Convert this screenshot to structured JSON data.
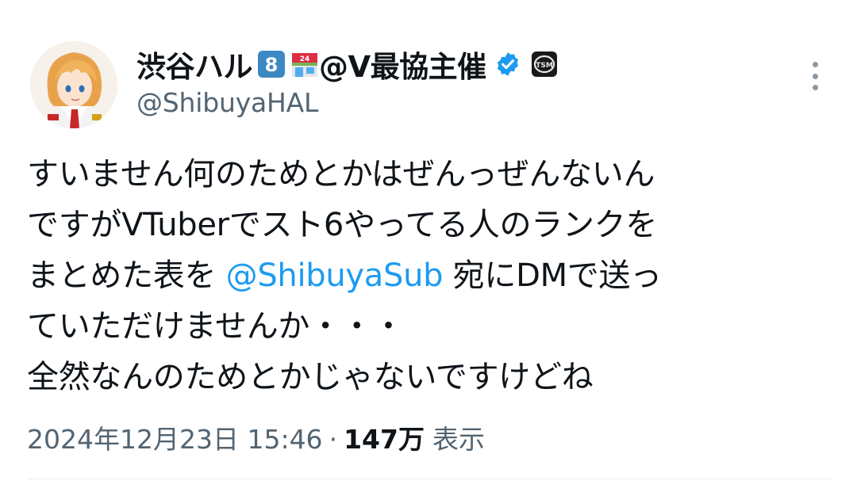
{
  "author": {
    "display_name": "渋谷ハル",
    "badge_number": "8",
    "store_badge_number": "24",
    "name_suffix": "@V最協主催",
    "handle": "@ShibuyaHAL",
    "verified": true,
    "icons": [
      "avatar-image",
      "keycap-8-icon",
      "convenience-store-icon",
      "verified-badge-icon",
      "tsm-team-icon"
    ]
  },
  "tweet": {
    "lines": [
      {
        "text": "すいません何のためとかはぜんっぜんないん"
      },
      {
        "text": "ですがVTuberでスト6やってる人のランクを"
      },
      {
        "before": "まとめた表を ",
        "mention": "@ShibuyaSub",
        "after": " 宛にDMで送っ"
      },
      {
        "text": "ていただけませんか・・・"
      },
      {
        "text": "全然なんのためとかじゃないですけどね"
      }
    ]
  },
  "meta": {
    "timestamp": "2024年12月23日 15:46",
    "separator": "·",
    "views_count": "147万",
    "views_label": "表示"
  },
  "colors": {
    "mention": "#1d9bf0",
    "secondary_text": "#536471",
    "verified": "#1d9bf0"
  }
}
